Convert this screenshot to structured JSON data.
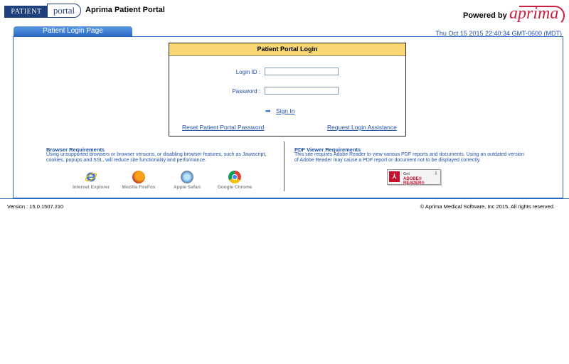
{
  "header": {
    "logo_word1": "PATIENT",
    "logo_word2": "portal",
    "app_title": "Aprima Patient Portal",
    "powered_by": "Powered by",
    "brand": "aprima"
  },
  "tab": {
    "label": "Patient Login Page"
  },
  "datetime": "Thu Oct 15 2015 22:40:34 GMT-0600 (MDT)",
  "login": {
    "title": "Patient Portal Login",
    "login_id_label": "Login ID",
    "login_id_value": "",
    "password_label": "Password",
    "password_value": "",
    "separator": ":",
    "sign_in": "Sign In",
    "reset_link": "Reset Patient Portal Password",
    "assist_link": "Request Login Assistance"
  },
  "browser_req": {
    "title": "Browser Requirements",
    "text": "Using unsupported browsers or browser versions, or disabling browser features, such as Javascript, cookies, popups and SSL, will reduce site functionality and performance.",
    "browsers": [
      {
        "name": "Internet Explorer",
        "icon": "ie-icon"
      },
      {
        "name": "Mozilla FireFox",
        "icon": "firefox-icon"
      },
      {
        "name": "Apple Safari",
        "icon": "safari-icon"
      },
      {
        "name": "Google Chrome",
        "icon": "chrome-icon"
      }
    ]
  },
  "pdf_req": {
    "title": "PDF Viewer Requirements",
    "text": "This site requires Adobe Reader to view various PDF reports and documents. Using an outdated version of Adobe Reader may cause a PDF report or document not to be displayed correctly.",
    "badge_get": "Get",
    "badge_name": "ADOBE® READER®"
  },
  "footer": {
    "version": "Version  :  15.0.1507.210",
    "copyright": "© Aprima Medical Software, Inc 2015. All rights reserved."
  },
  "colors": {
    "accent": "#2a6ac6",
    "link": "#1d4fae",
    "login_header": "#f9d873",
    "brand_red": "#c8203e"
  }
}
